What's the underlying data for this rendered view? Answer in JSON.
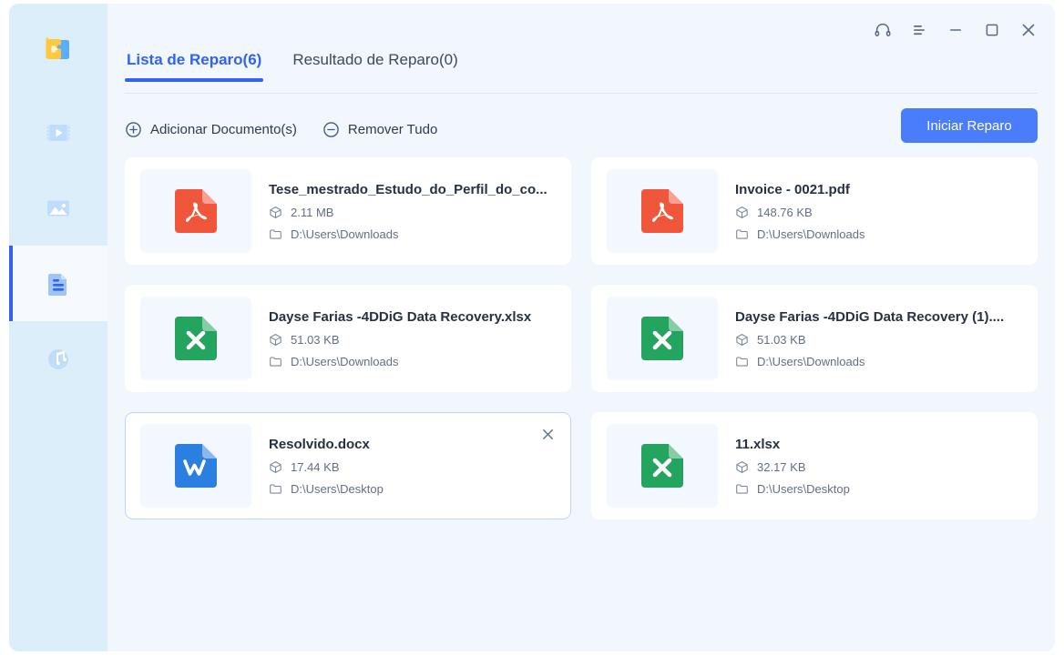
{
  "sidebar": {
    "logo_name": "4ddig-logo",
    "items": [
      {
        "name": "video-repair",
        "icon": "video-icon",
        "active": false
      },
      {
        "name": "photo-repair",
        "icon": "image-icon",
        "active": false
      },
      {
        "name": "document-repair",
        "icon": "document-icon",
        "active": true
      },
      {
        "name": "audio-repair",
        "icon": "music-icon",
        "active": false
      }
    ]
  },
  "window": {
    "support_label": "Suporte",
    "menu_label": "Menu",
    "minimize_label": "Minimizar",
    "maximize_label": "Maximizar",
    "close_label": "Fechar"
  },
  "tabs": [
    {
      "label": "Lista de Reparo(6)",
      "active": true
    },
    {
      "label": "Resultado de Reparo(0)",
      "active": false
    }
  ],
  "toolbar": {
    "add_label": "Adicionar Documento(s)",
    "remove_label": "Remover Tudo",
    "start_label": "Iniciar Reparo"
  },
  "colors": {
    "accent": "#2f62f5",
    "button": "#4a7dfb",
    "pdf": "#f0563a",
    "excel": "#23a55f",
    "word": "#2a7fe0",
    "sidebar_bg": "#ddeefb",
    "main_bg": "#f2f6fd",
    "card_bg": "#ffffff",
    "selected_border": "#c3d5f7"
  },
  "files": [
    {
      "name": "Tese_mestrado_Estudo_do_Perfil_do_co...",
      "size": "2.11 MB",
      "path": "D:\\Users\\Downloads",
      "type": "pdf",
      "selected": false
    },
    {
      "name": "Invoice - 0021.pdf",
      "size": "148.76 KB",
      "path": "D:\\Users\\Downloads",
      "type": "pdf",
      "selected": false
    },
    {
      "name": "Dayse Farias -4DDiG Data Recovery.xlsx",
      "size": "51.03 KB",
      "path": "D:\\Users\\Downloads",
      "type": "excel",
      "selected": false
    },
    {
      "name": "Dayse Farias -4DDiG Data Recovery (1)....",
      "size": "51.03 KB",
      "path": "D:\\Users\\Downloads",
      "type": "excel",
      "selected": false
    },
    {
      "name": "Resolvido.docx",
      "size": "17.44 KB",
      "path": "D:\\Users\\Desktop",
      "type": "word",
      "selected": true
    },
    {
      "name": "11.xlsx",
      "size": "32.17 KB",
      "path": "D:\\Users\\Desktop",
      "type": "excel",
      "selected": false
    }
  ]
}
